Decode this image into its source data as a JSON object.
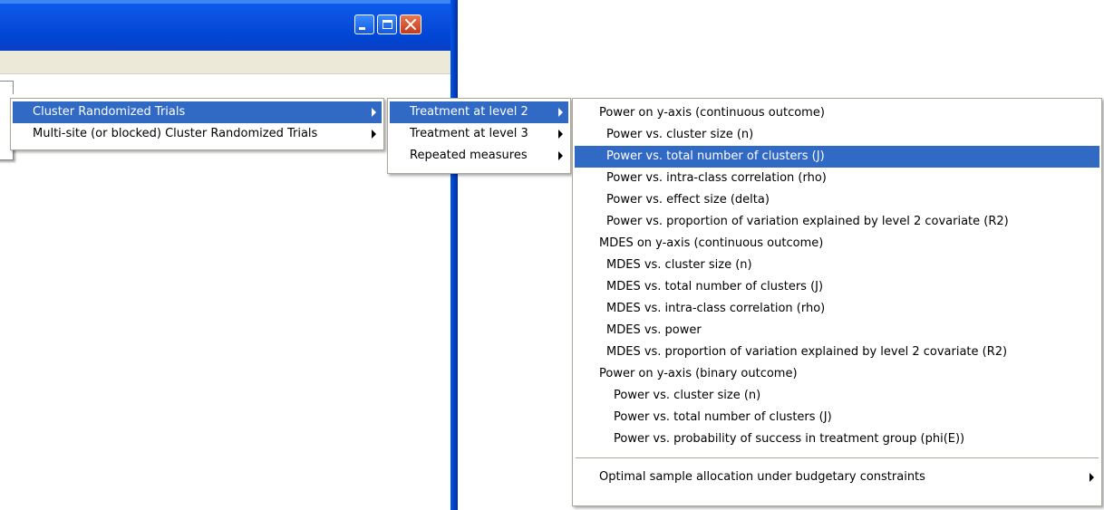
{
  "window": {
    "buttons": {
      "minimize_icon": "minimize-icon",
      "maximize_icon": "maximize-icon",
      "close_icon": "close-icon"
    }
  },
  "menu1": {
    "items": [
      {
        "label": "Cluster Randomized Trials",
        "selected": true,
        "has_submenu": true
      },
      {
        "label": "Multi-site (or blocked) Cluster Randomized Trials",
        "selected": false,
        "has_submenu": true
      }
    ]
  },
  "menu2": {
    "items": [
      {
        "label": "Treatment at level 2",
        "selected": true,
        "has_submenu": true
      },
      {
        "label": "Treatment at level 3",
        "selected": false,
        "has_submenu": true
      },
      {
        "label": "Repeated measures",
        "selected": false,
        "has_submenu": true
      }
    ]
  },
  "menu3": {
    "items": [
      {
        "label": "Power on y-axis (continuous outcome)",
        "indent": 0
      },
      {
        "label": "Power vs. cluster size (n)",
        "indent": 1
      },
      {
        "label": "Power vs. total number of clusters (J)",
        "indent": 1,
        "selected": true
      },
      {
        "label": "Power vs. intra-class correlation (rho)",
        "indent": 1
      },
      {
        "label": "Power vs. effect size (delta)",
        "indent": 1
      },
      {
        "label": "Power vs. proportion of variation explained by level 2 covariate (R2)",
        "indent": 1
      },
      {
        "label": "MDES on y-axis (continuous outcome)",
        "indent": 0
      },
      {
        "label": "MDES vs. cluster size (n)",
        "indent": 1
      },
      {
        "label": "MDES vs. total number of clusters (J)",
        "indent": 1
      },
      {
        "label": "MDES vs. intra-class correlation (rho)",
        "indent": 1
      },
      {
        "label": "MDES vs. power",
        "indent": 1
      },
      {
        "label": "MDES vs. proportion of variation explained by level 2 covariate (R2)",
        "indent": 1
      },
      {
        "label": "Power on y-axis (binary outcome)",
        "indent": 0
      },
      {
        "label": "Power vs. cluster size (n)",
        "indent": 2
      },
      {
        "label": "Power vs. total number of clusters (J)",
        "indent": 2
      },
      {
        "label": "Power vs. probability of success in treatment group (phi(E))",
        "indent": 2
      }
    ],
    "footer_item": {
      "label": "Optimal sample allocation under budgetary constraints",
      "has_submenu": true
    }
  },
  "colors": {
    "selection": "#316ac5",
    "titlebar": "#0054e3",
    "menu_bg": "#ffffff",
    "menubar_bg": "#ece9d8"
  }
}
